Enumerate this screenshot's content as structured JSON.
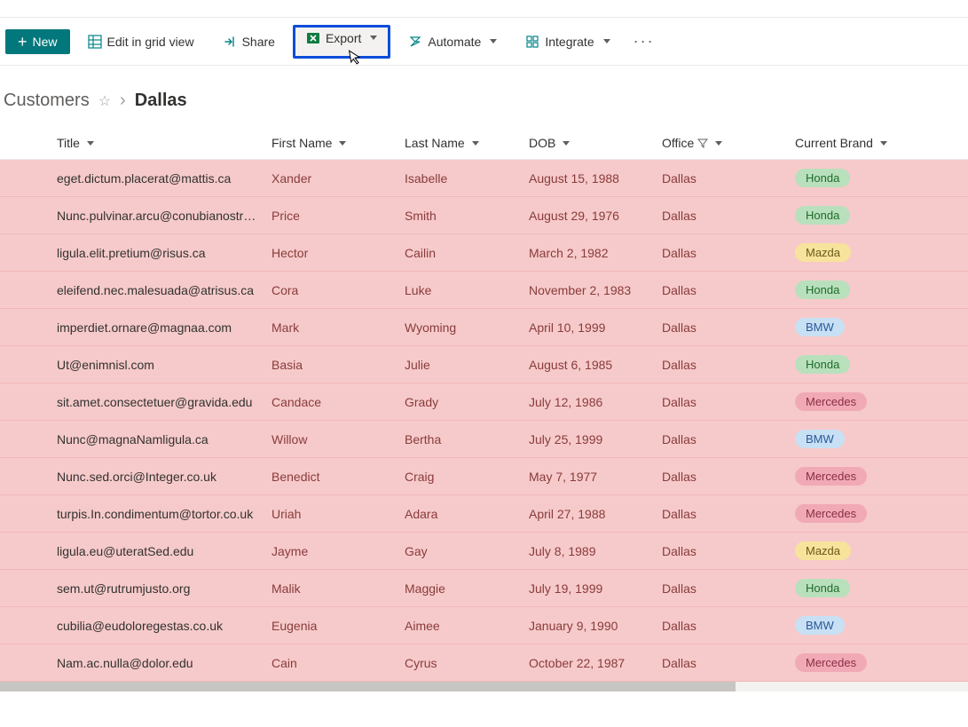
{
  "toolbar": {
    "new_label": "New",
    "edit_grid_label": "Edit in grid view",
    "share_label": "Share",
    "export_label": "Export",
    "automate_label": "Automate",
    "integrate_label": "Integrate"
  },
  "breadcrumb": {
    "root": "Customers",
    "current": "Dallas"
  },
  "columns": {
    "title": "Title",
    "first_name": "First Name",
    "last_name": "Last Name",
    "dob": "DOB",
    "office": "Office",
    "current_brand": "Current Brand"
  },
  "brand_styles": {
    "Honda": "pill-honda",
    "Mazda": "pill-mazda",
    "BMW": "pill-bmw",
    "Mercedes": "pill-mercedes"
  },
  "rows": [
    {
      "title": "eget.dictum.placerat@mattis.ca",
      "first": "Xander",
      "last": "Isabelle",
      "dob": "August 15, 1988",
      "office": "Dallas",
      "brand": "Honda"
    },
    {
      "title": "Nunc.pulvinar.arcu@conubianostraper.edu",
      "first": "Price",
      "last": "Smith",
      "dob": "August 29, 1976",
      "office": "Dallas",
      "brand": "Honda"
    },
    {
      "title": "ligula.elit.pretium@risus.ca",
      "first": "Hector",
      "last": "Cailin",
      "dob": "March 2, 1982",
      "office": "Dallas",
      "brand": "Mazda"
    },
    {
      "title": "eleifend.nec.malesuada@atrisus.ca",
      "first": "Cora",
      "last": "Luke",
      "dob": "November 2, 1983",
      "office": "Dallas",
      "brand": "Honda"
    },
    {
      "title": "imperdiet.ornare@magnaa.com",
      "first": "Mark",
      "last": "Wyoming",
      "dob": "April 10, 1999",
      "office": "Dallas",
      "brand": "BMW"
    },
    {
      "title": "Ut@enimnisl.com",
      "first": "Basia",
      "last": "Julie",
      "dob": "August 6, 1985",
      "office": "Dallas",
      "brand": "Honda"
    },
    {
      "title": "sit.amet.consectetuer@gravida.edu",
      "first": "Candace",
      "last": "Grady",
      "dob": "July 12, 1986",
      "office": "Dallas",
      "brand": "Mercedes"
    },
    {
      "title": "Nunc@magnaNamligula.ca",
      "first": "Willow",
      "last": "Bertha",
      "dob": "July 25, 1999",
      "office": "Dallas",
      "brand": "BMW"
    },
    {
      "title": "Nunc.sed.orci@Integer.co.uk",
      "first": "Benedict",
      "last": "Craig",
      "dob": "May 7, 1977",
      "office": "Dallas",
      "brand": "Mercedes"
    },
    {
      "title": "turpis.In.condimentum@tortor.co.uk",
      "first": "Uriah",
      "last": "Adara",
      "dob": "April 27, 1988",
      "office": "Dallas",
      "brand": "Mercedes"
    },
    {
      "title": "ligula.eu@uteratSed.edu",
      "first": "Jayme",
      "last": "Gay",
      "dob": "July 8, 1989",
      "office": "Dallas",
      "brand": "Mazda"
    },
    {
      "title": "sem.ut@rutrumjusto.org",
      "first": "Malik",
      "last": "Maggie",
      "dob": "July 19, 1999",
      "office": "Dallas",
      "brand": "Honda"
    },
    {
      "title": "cubilia@eudoloregestas.co.uk",
      "first": "Eugenia",
      "last": "Aimee",
      "dob": "January 9, 1990",
      "office": "Dallas",
      "brand": "BMW"
    },
    {
      "title": "Nam.ac.nulla@dolor.edu",
      "first": "Cain",
      "last": "Cyrus",
      "dob": "October 22, 1987",
      "office": "Dallas",
      "brand": "Mercedes"
    }
  ]
}
